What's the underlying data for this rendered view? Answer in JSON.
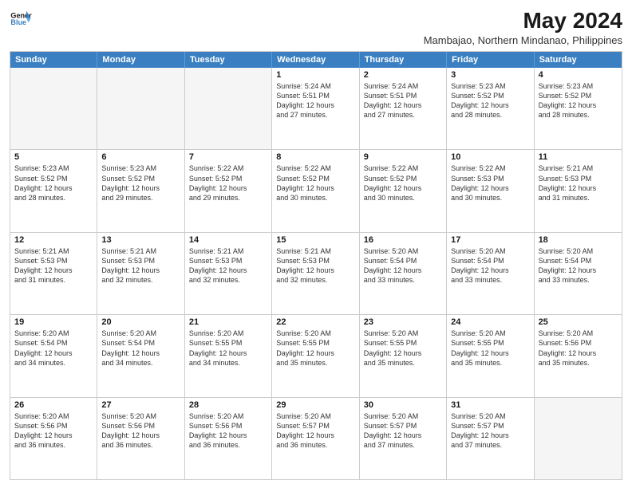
{
  "logo": {
    "line1": "General",
    "line2": "Blue"
  },
  "title": "May 2024",
  "subtitle": "Mambajao, Northern Mindanao, Philippines",
  "days": [
    "Sunday",
    "Monday",
    "Tuesday",
    "Wednesday",
    "Thursday",
    "Friday",
    "Saturday"
  ],
  "weeks": [
    [
      {
        "day": "",
        "info": "",
        "empty": true
      },
      {
        "day": "",
        "info": "",
        "empty": true
      },
      {
        "day": "",
        "info": "",
        "empty": true
      },
      {
        "day": "1",
        "info": "Sunrise: 5:24 AM\nSunset: 5:51 PM\nDaylight: 12 hours\nand 27 minutes."
      },
      {
        "day": "2",
        "info": "Sunrise: 5:24 AM\nSunset: 5:51 PM\nDaylight: 12 hours\nand 27 minutes."
      },
      {
        "day": "3",
        "info": "Sunrise: 5:23 AM\nSunset: 5:52 PM\nDaylight: 12 hours\nand 28 minutes."
      },
      {
        "day": "4",
        "info": "Sunrise: 5:23 AM\nSunset: 5:52 PM\nDaylight: 12 hours\nand 28 minutes."
      }
    ],
    [
      {
        "day": "5",
        "info": "Sunrise: 5:23 AM\nSunset: 5:52 PM\nDaylight: 12 hours\nand 28 minutes."
      },
      {
        "day": "6",
        "info": "Sunrise: 5:23 AM\nSunset: 5:52 PM\nDaylight: 12 hours\nand 29 minutes."
      },
      {
        "day": "7",
        "info": "Sunrise: 5:22 AM\nSunset: 5:52 PM\nDaylight: 12 hours\nand 29 minutes."
      },
      {
        "day": "8",
        "info": "Sunrise: 5:22 AM\nSunset: 5:52 PM\nDaylight: 12 hours\nand 30 minutes."
      },
      {
        "day": "9",
        "info": "Sunrise: 5:22 AM\nSunset: 5:52 PM\nDaylight: 12 hours\nand 30 minutes."
      },
      {
        "day": "10",
        "info": "Sunrise: 5:22 AM\nSunset: 5:53 PM\nDaylight: 12 hours\nand 30 minutes."
      },
      {
        "day": "11",
        "info": "Sunrise: 5:21 AM\nSunset: 5:53 PM\nDaylight: 12 hours\nand 31 minutes."
      }
    ],
    [
      {
        "day": "12",
        "info": "Sunrise: 5:21 AM\nSunset: 5:53 PM\nDaylight: 12 hours\nand 31 minutes."
      },
      {
        "day": "13",
        "info": "Sunrise: 5:21 AM\nSunset: 5:53 PM\nDaylight: 12 hours\nand 32 minutes."
      },
      {
        "day": "14",
        "info": "Sunrise: 5:21 AM\nSunset: 5:53 PM\nDaylight: 12 hours\nand 32 minutes."
      },
      {
        "day": "15",
        "info": "Sunrise: 5:21 AM\nSunset: 5:53 PM\nDaylight: 12 hours\nand 32 minutes."
      },
      {
        "day": "16",
        "info": "Sunrise: 5:20 AM\nSunset: 5:54 PM\nDaylight: 12 hours\nand 33 minutes."
      },
      {
        "day": "17",
        "info": "Sunrise: 5:20 AM\nSunset: 5:54 PM\nDaylight: 12 hours\nand 33 minutes."
      },
      {
        "day": "18",
        "info": "Sunrise: 5:20 AM\nSunset: 5:54 PM\nDaylight: 12 hours\nand 33 minutes."
      }
    ],
    [
      {
        "day": "19",
        "info": "Sunrise: 5:20 AM\nSunset: 5:54 PM\nDaylight: 12 hours\nand 34 minutes."
      },
      {
        "day": "20",
        "info": "Sunrise: 5:20 AM\nSunset: 5:54 PM\nDaylight: 12 hours\nand 34 minutes."
      },
      {
        "day": "21",
        "info": "Sunrise: 5:20 AM\nSunset: 5:55 PM\nDaylight: 12 hours\nand 34 minutes."
      },
      {
        "day": "22",
        "info": "Sunrise: 5:20 AM\nSunset: 5:55 PM\nDaylight: 12 hours\nand 35 minutes."
      },
      {
        "day": "23",
        "info": "Sunrise: 5:20 AM\nSunset: 5:55 PM\nDaylight: 12 hours\nand 35 minutes."
      },
      {
        "day": "24",
        "info": "Sunrise: 5:20 AM\nSunset: 5:55 PM\nDaylight: 12 hours\nand 35 minutes."
      },
      {
        "day": "25",
        "info": "Sunrise: 5:20 AM\nSunset: 5:56 PM\nDaylight: 12 hours\nand 35 minutes."
      }
    ],
    [
      {
        "day": "26",
        "info": "Sunrise: 5:20 AM\nSunset: 5:56 PM\nDaylight: 12 hours\nand 36 minutes."
      },
      {
        "day": "27",
        "info": "Sunrise: 5:20 AM\nSunset: 5:56 PM\nDaylight: 12 hours\nand 36 minutes."
      },
      {
        "day": "28",
        "info": "Sunrise: 5:20 AM\nSunset: 5:56 PM\nDaylight: 12 hours\nand 36 minutes."
      },
      {
        "day": "29",
        "info": "Sunrise: 5:20 AM\nSunset: 5:57 PM\nDaylight: 12 hours\nand 36 minutes."
      },
      {
        "day": "30",
        "info": "Sunrise: 5:20 AM\nSunset: 5:57 PM\nDaylight: 12 hours\nand 37 minutes."
      },
      {
        "day": "31",
        "info": "Sunrise: 5:20 AM\nSunset: 5:57 PM\nDaylight: 12 hours\nand 37 minutes."
      },
      {
        "day": "",
        "info": "",
        "empty": true
      }
    ]
  ]
}
